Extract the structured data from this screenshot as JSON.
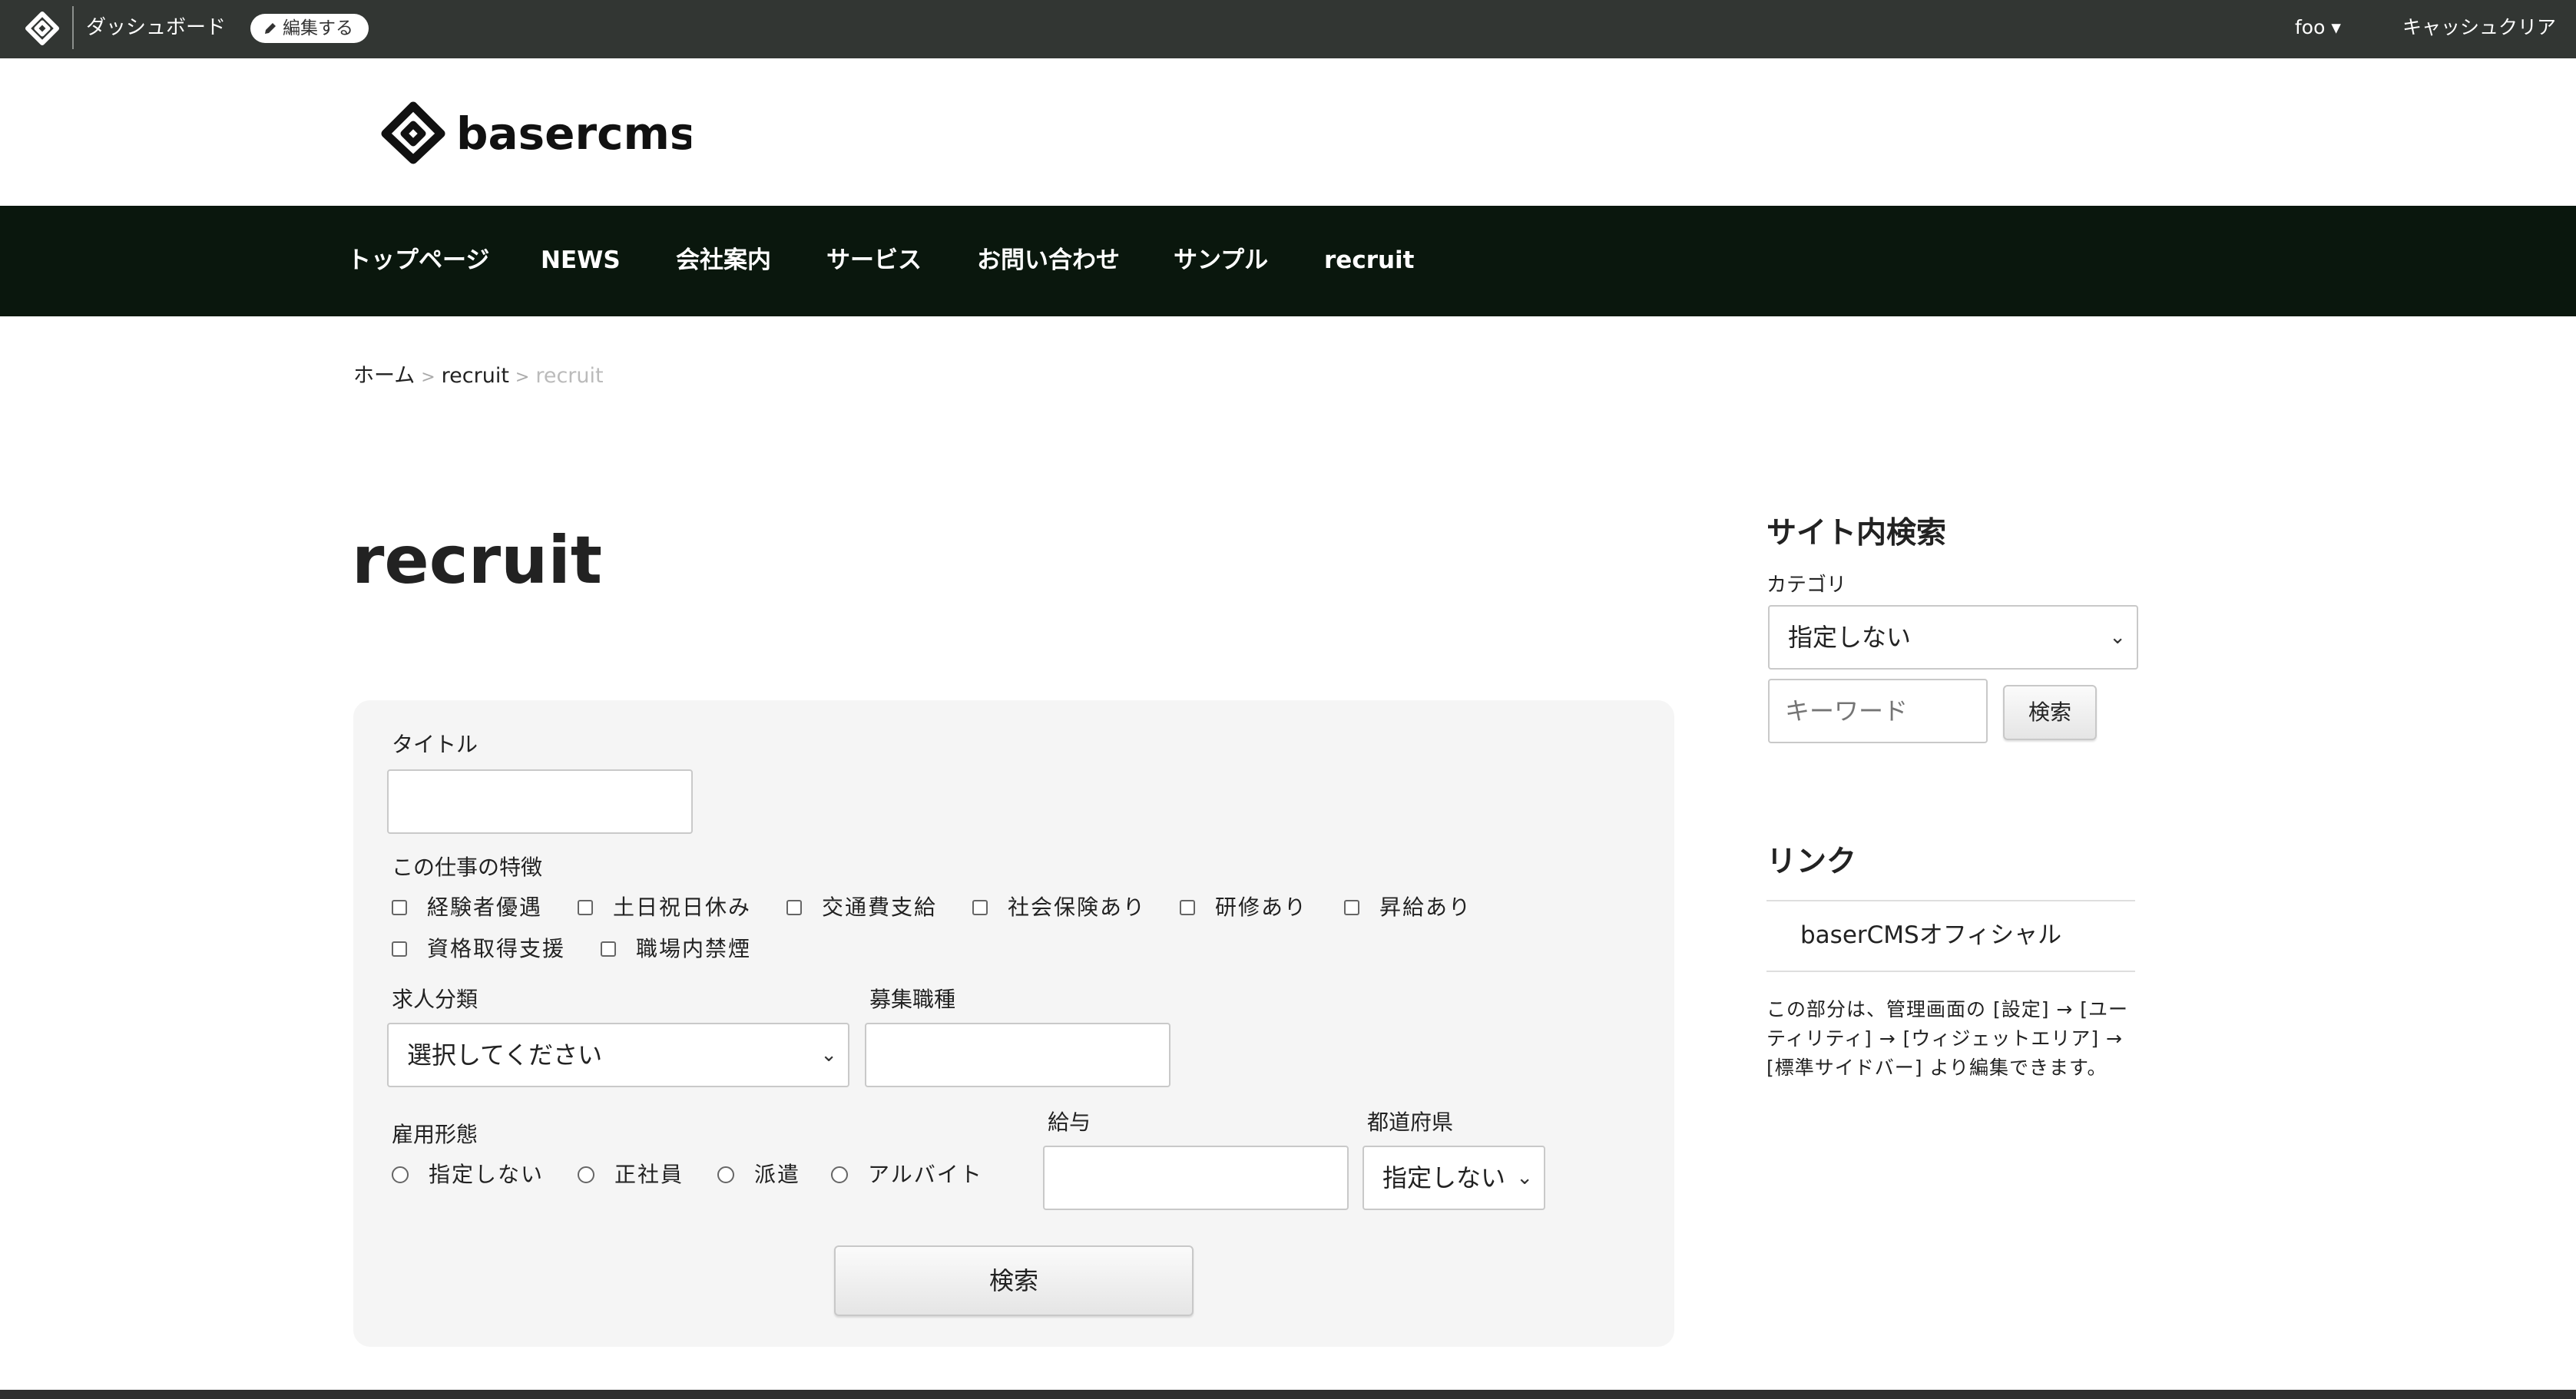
{
  "admin_bar": {
    "dashboard": "ダッシュボード",
    "edit": "編集する",
    "user": "foo ▾",
    "cache_clear": "キャッシュクリア"
  },
  "brand": {
    "logo_text": "basercms"
  },
  "nav": [
    "トップページ",
    "NEWS",
    "会社案内",
    "サービス",
    "お問い合わせ",
    "サンプル",
    "recruit"
  ],
  "breadcrumb": {
    "home": "ホーム",
    "parent": "recruit",
    "current": "recruit",
    "separator": ">"
  },
  "page_title": "recruit",
  "search_form": {
    "title_label": "タイトル",
    "title_value": "",
    "features_label": "この仕事の特徴",
    "features": [
      "経験者優遇",
      "土日祝日休み",
      "交通費支給",
      "社会保険あり",
      "研修あり",
      "昇給あり",
      "資格取得支援",
      "職場内禁煙"
    ],
    "category_label": "求人分類",
    "category_value": "選択してください",
    "job_type_label": "募集職種",
    "job_type_value": "",
    "employment_label": "雇用形態",
    "employment_options": [
      "指定しない",
      "正社員",
      "派遣",
      "アルバイト"
    ],
    "salary_label": "給与",
    "salary_value": "",
    "prefecture_label": "都道府県",
    "prefecture_value": "指定しない",
    "submit": "検索"
  },
  "sidebar": {
    "search_heading": "サイト内検索",
    "category_label": "カテゴリ",
    "category_value": "指定しない",
    "keyword_placeholder": "キーワード",
    "search_button": "検索",
    "links_heading": "リンク",
    "link": "baserCMSオフィシャル",
    "note": "この部分は、管理画面の [設定] → [ユーティリティ] → [ウィジェットエリア] → [標準サイドバー] より編集できます。"
  },
  "colors": {
    "admin_bar": "#323633",
    "nav": "#0a170d",
    "panel": "#f5f5f5"
  }
}
